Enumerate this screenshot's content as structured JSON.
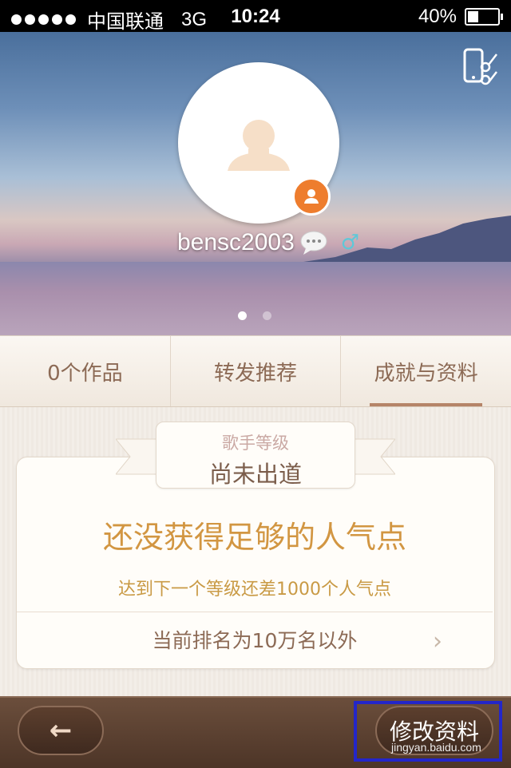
{
  "status_bar": {
    "carrier": "中国联通",
    "network": "3G",
    "time": "10:24",
    "battery": "40%",
    "battery_level": 0.4
  },
  "profile": {
    "username": "bensc2003",
    "gender_symbol": "♂",
    "pager_active_index": 0,
    "pager_count": 2
  },
  "tabs": [
    {
      "label": "0个作品",
      "active": false
    },
    {
      "label": "转发推荐",
      "active": false
    },
    {
      "label": "成就与资料",
      "active": true
    }
  ],
  "achievement": {
    "level_label": "歌手等级",
    "level_value": "尚未出道",
    "headline": "还没获得足够的人气点",
    "subline": "达到下一个等级还差1000个人气点",
    "rank_text": "当前排名为10万名以外",
    "chevron": "›"
  },
  "bottom_bar": {
    "back_arrow": "←",
    "edit_label": "修改资料",
    "watermark": "jingyan.baidu.com"
  },
  "colors": {
    "accent_orange": "#ee7d2e",
    "headline_gold": "#d29642",
    "highlight_blue": "#2326c9"
  }
}
